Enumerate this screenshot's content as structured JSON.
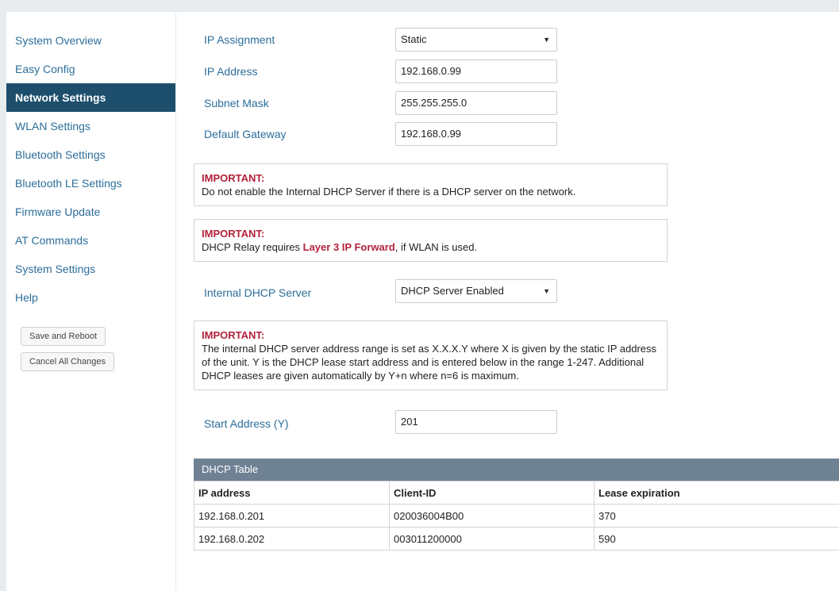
{
  "sidebar": {
    "items": [
      {
        "label": "System Overview"
      },
      {
        "label": "Easy Config"
      },
      {
        "label": "Network Settings"
      },
      {
        "label": "WLAN Settings"
      },
      {
        "label": "Bluetooth Settings"
      },
      {
        "label": "Bluetooth LE Settings"
      },
      {
        "label": "Firmware Update"
      },
      {
        "label": "AT Commands"
      },
      {
        "label": "System Settings"
      },
      {
        "label": "Help"
      }
    ],
    "active_item": "Network Settings",
    "save_reboot_label": "Save and Reboot",
    "cancel_changes_label": "Cancel All Changes"
  },
  "form": {
    "ip_assignment": {
      "label": "IP Assignment",
      "value": "Static"
    },
    "ip_address": {
      "label": "IP Address",
      "value": "192.168.0.99"
    },
    "subnet_mask": {
      "label": "Subnet Mask",
      "value": "255.255.255.0"
    },
    "default_gateway": {
      "label": "Default Gateway",
      "value": "192.168.0.99"
    },
    "dhcp_server": {
      "label": "Internal DHCP Server",
      "value": "DHCP Server Enabled"
    },
    "start_address": {
      "label": "Start Address (Y)",
      "value": "201"
    }
  },
  "notes": {
    "important_label": "IMPORTANT:",
    "note1": "Do not enable the Internal DHCP Server if there is a DHCP server on the network.",
    "note2_pre": "DHCP Relay requires ",
    "note2_highlight": "Layer 3 IP Forward",
    "note2_post": ", if WLAN is used.",
    "note3": "The internal DHCP server address range is set as X.X.X.Y where X is given by the static IP address of the unit. Y is the DHCP lease start address and is entered below in the range 1-247. Additional DHCP leases are given automatically by Y+n where n=6 is maximum.",
    "important_color": "#b3223a"
  },
  "dhcp_table": {
    "title": "DHCP Table",
    "headers": [
      "IP address",
      "Client-ID",
      "Lease expiration"
    ],
    "rows": [
      [
        "192.168.0.201",
        "020036004B00",
        "370"
      ],
      [
        "192.168.0.202",
        "003011200000",
        "590"
      ]
    ]
  },
  "colors": {
    "sidebar_active_bg": "#1d4f6d",
    "link_blue": "#2c6e9a",
    "table_header_bg": "#6f8294"
  },
  "icons": {
    "dropdown": "chevron-down-icon"
  }
}
